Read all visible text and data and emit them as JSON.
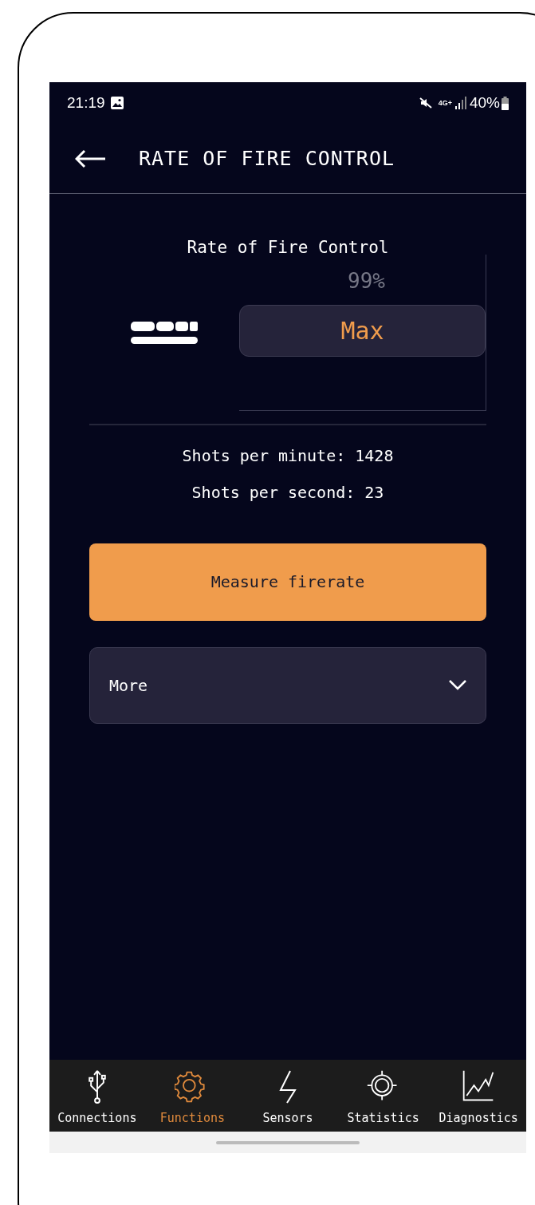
{
  "status_bar": {
    "time": "21:19",
    "network": "4G+",
    "battery": "40%"
  },
  "header": {
    "title": "RATE OF FIRE CONTROL"
  },
  "control": {
    "label": "Rate of Fire Control",
    "reading": "99%",
    "value": "Max"
  },
  "stats": [
    "Shots per minute: 1428",
    "Shots per second: 23"
  ],
  "measure_button": "Measure firerate",
  "more": {
    "label": "More",
    "expanded": false
  },
  "nav": [
    {
      "label": "Connections",
      "kind": "usb",
      "selected": false
    },
    {
      "label": "Functions",
      "kind": "gear",
      "selected": true
    },
    {
      "label": "Sensors",
      "kind": "bolt",
      "selected": false
    },
    {
      "label": "Statistics",
      "kind": "target",
      "selected": false
    },
    {
      "label": "Diagnostics",
      "kind": "chart",
      "selected": false
    }
  ]
}
